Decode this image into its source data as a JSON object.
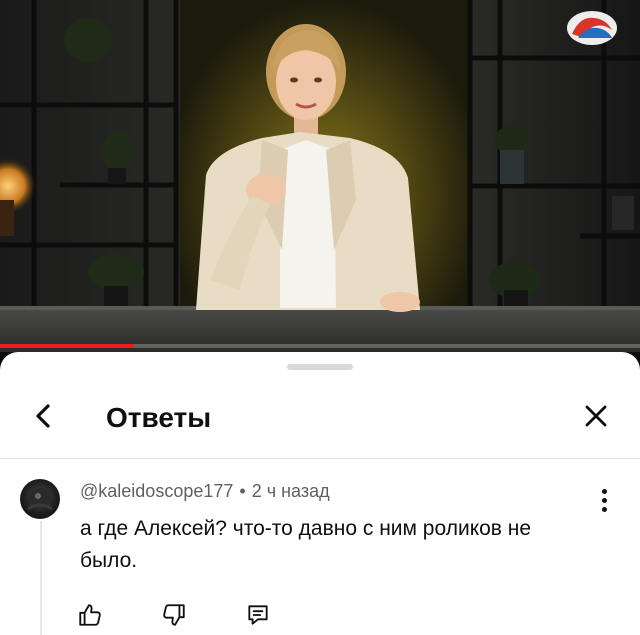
{
  "video": {
    "progress_fraction": 0.21
  },
  "sheet": {
    "title": "Ответы"
  },
  "comment": {
    "author": "@kaleidoscope177",
    "separator": "•",
    "time": "2 ч назад",
    "text": "а где Алексей? что-то давно с ним роликов не было."
  },
  "icons": {
    "back": "chevron-left-icon",
    "close": "close-icon",
    "more": "more-vertical-icon",
    "like": "thumbs-up-icon",
    "dislike": "thumbs-down-icon",
    "reply": "reply-icon"
  },
  "colors": {
    "progress": "#e62117",
    "text_primary": "#0f0f0f",
    "text_secondary": "#606060"
  }
}
